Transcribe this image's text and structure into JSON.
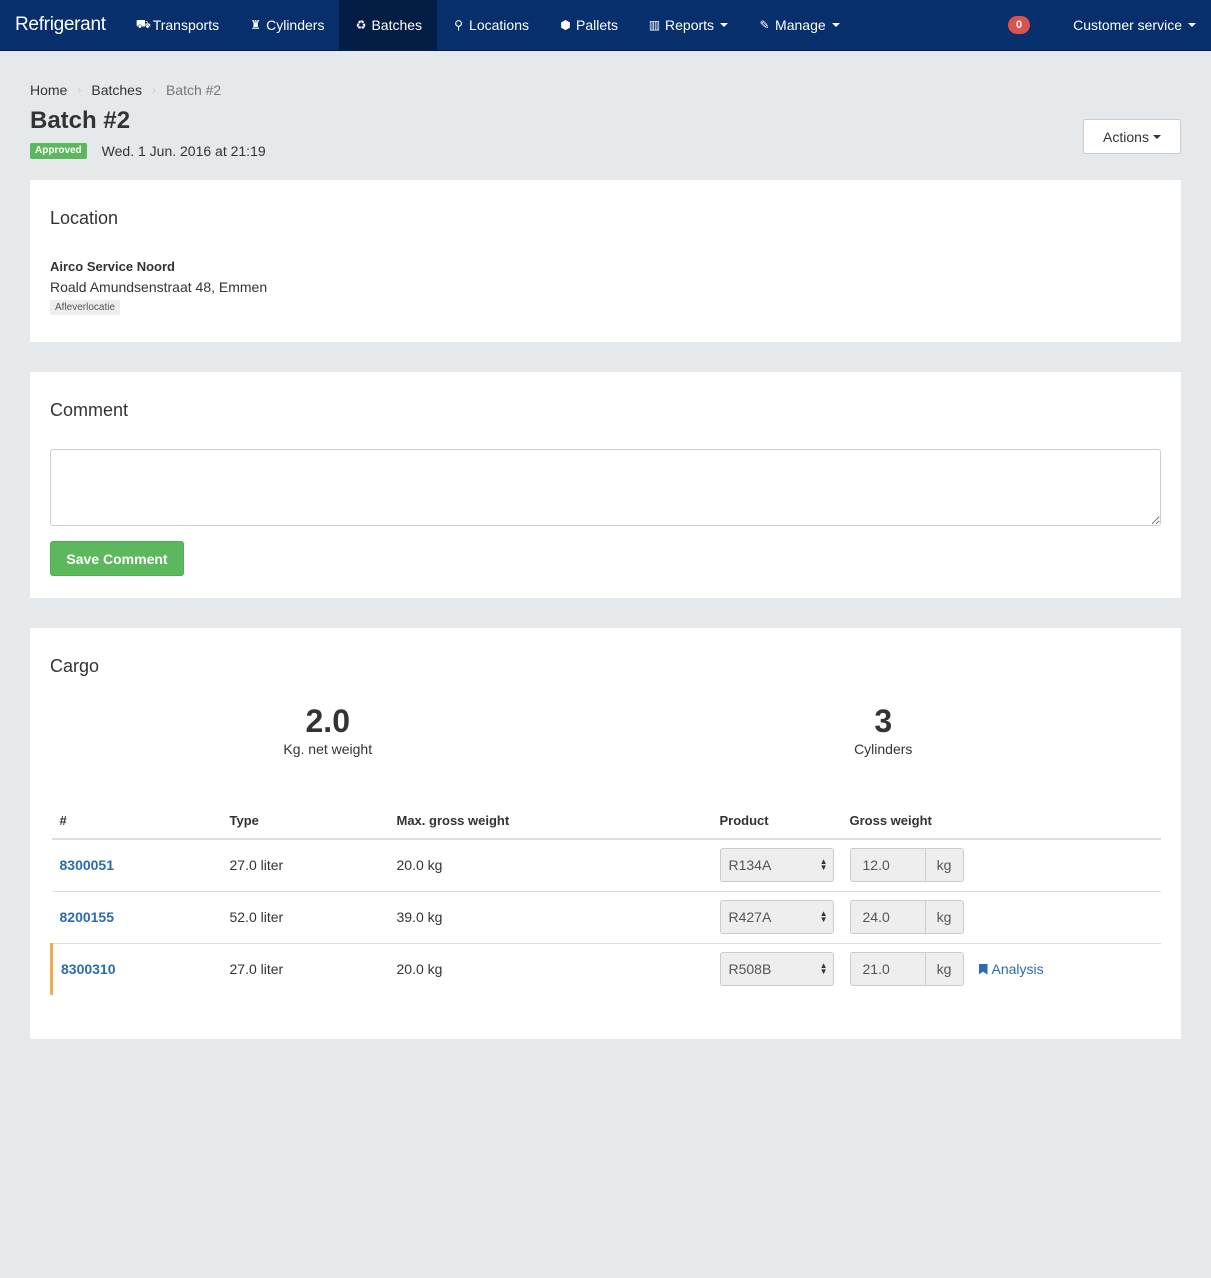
{
  "navbar": {
    "brand": "Refrigerant",
    "items": [
      {
        "label": "Transports",
        "icon": "truck-icon",
        "glyph": "⛟"
      },
      {
        "label": "Cylinders",
        "icon": "fire-extinguisher-icon",
        "glyph": "♜"
      },
      {
        "label": "Batches",
        "icon": "recycle-icon",
        "glyph": "♻",
        "active": true
      },
      {
        "label": "Locations",
        "icon": "map-marker-icon",
        "glyph": "⚲"
      },
      {
        "label": "Pallets",
        "icon": "cubes-icon",
        "glyph": "⬢"
      },
      {
        "label": "Reports",
        "icon": "bar-chart-icon",
        "glyph": "▥",
        "dropdown": true
      },
      {
        "label": "Manage",
        "icon": "edit-icon",
        "glyph": "✎",
        "dropdown": true
      }
    ],
    "notification_count": "0",
    "user_menu": "Customer service"
  },
  "breadcrumb": {
    "home": "Home",
    "batches": "Batches",
    "current": "Batch #2"
  },
  "page": {
    "title": "Batch #2",
    "status": "Approved",
    "status_color": "#5cb85c",
    "date": "Wed. 1 Jun. 2016 at 21:19",
    "actions_label": "Actions"
  },
  "location": {
    "heading": "Location",
    "name": "Airco Service Noord",
    "address": "Roald Amundsenstraat 48, Emmen",
    "tag": "Afleverlocatie"
  },
  "comment": {
    "heading": "Comment",
    "value": "",
    "placeholder": "",
    "save_label": "Save Comment"
  },
  "cargo": {
    "heading": "Cargo",
    "net_weight": "2.0",
    "net_weight_label": "Kg. net weight",
    "cylinders": "3",
    "cylinders_label": "Cylinders",
    "columns": [
      "#",
      "Type",
      "Max. gross weight",
      "Product",
      "Gross weight"
    ],
    "rows": [
      {
        "id": "8300051",
        "type": "27.0 liter",
        "max": "20.0 kg",
        "product": "R134A",
        "gross": "12.0",
        "unit": "kg",
        "analysis": ""
      },
      {
        "id": "8200155",
        "type": "52.0 liter",
        "max": "39.0 kg",
        "product": "R427A",
        "gross": "24.0",
        "unit": "kg",
        "analysis": ""
      },
      {
        "id": "8300310",
        "type": "27.0 liter",
        "max": "20.0 kg",
        "product": "R508B",
        "gross": "21.0",
        "unit": "kg",
        "analysis": "Analysis",
        "warning": true
      }
    ]
  }
}
